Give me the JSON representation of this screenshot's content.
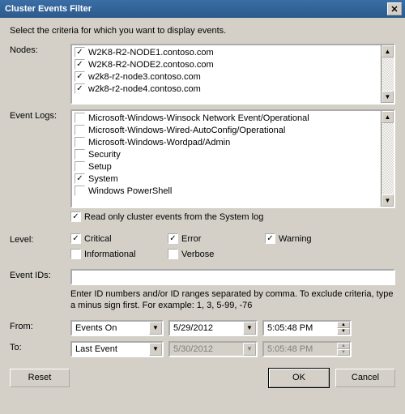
{
  "title": "Cluster Events Filter",
  "instruction": "Select the criteria for which you want to display events.",
  "labels": {
    "nodes": "Nodes:",
    "eventlogs": "Event Logs:",
    "level": "Level:",
    "eventids": "Event IDs:",
    "from": "From:",
    "to": "To:"
  },
  "nodes": [
    {
      "label": "W2K8-R2-NODE1.contoso.com",
      "checked": true
    },
    {
      "label": "W2K8-R2-NODE2.contoso.com",
      "checked": true
    },
    {
      "label": "w2k8-r2-node3.contoso.com",
      "checked": true
    },
    {
      "label": "w2k8-r2-node4.contoso.com",
      "checked": true
    }
  ],
  "eventlogs": [
    {
      "label": "Microsoft-Windows-Winsock Network Event/Operational",
      "checked": false
    },
    {
      "label": "Microsoft-Windows-Wired-AutoConfig/Operational",
      "checked": false
    },
    {
      "label": "Microsoft-Windows-Wordpad/Admin",
      "checked": false
    },
    {
      "label": "Security",
      "checked": false
    },
    {
      "label": "Setup",
      "checked": false
    },
    {
      "label": "System",
      "checked": true
    },
    {
      "label": "Windows PowerShell",
      "checked": false
    }
  ],
  "syslog": {
    "label": "Read only cluster events from the System log",
    "checked": true
  },
  "levels": {
    "critical": {
      "label": "Critical",
      "checked": true
    },
    "error": {
      "label": "Error",
      "checked": true
    },
    "warning": {
      "label": "Warning",
      "checked": true
    },
    "informational": {
      "label": "Informational",
      "checked": false
    },
    "verbose": {
      "label": "Verbose",
      "checked": false
    }
  },
  "eventids_value": "",
  "eventids_hint": "Enter ID numbers and/or ID ranges separated by comma. To exclude criteria, type a minus sign first. For example: 1, 3, 5-99, -76",
  "from": {
    "mode": "Events On",
    "date": "5/29/2012",
    "time": "5:05:48 PM"
  },
  "to": {
    "mode": "Last Event",
    "date": "5/30/2012",
    "time": "5:05:48 PM"
  },
  "buttons": {
    "reset": "Reset",
    "ok": "OK",
    "cancel": "Cancel"
  },
  "chk": "✓"
}
